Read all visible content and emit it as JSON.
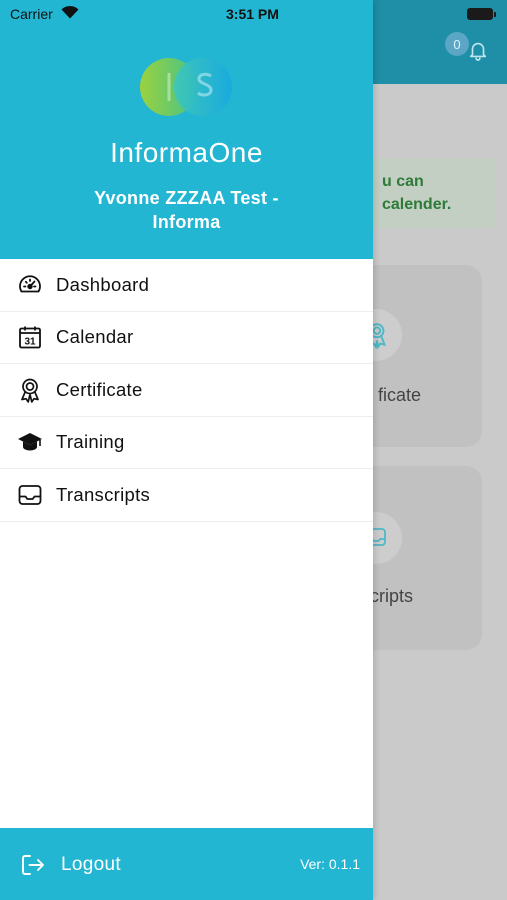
{
  "status_bar": {
    "carrier": "Carrier",
    "time": "3:51 PM"
  },
  "drawer": {
    "app_name": "InformaOne",
    "user_name": "Yvonne ZZZAA Test - Informa",
    "menu": [
      {
        "label": "Dashboard",
        "icon": "speedometer-icon"
      },
      {
        "label": "Calendar",
        "icon": "calendar-icon",
        "icon_text": "31"
      },
      {
        "label": "Certificate",
        "icon": "award-ribbon-icon"
      },
      {
        "label": "Training",
        "icon": "graduation-cap-icon"
      },
      {
        "label": "Transcripts",
        "icon": "inbox-tray-icon"
      }
    ],
    "logout_label": "Logout",
    "version": "Ver: 0.1.1"
  },
  "background": {
    "notification_count": "0",
    "notice_text_line1": "u can",
    "notice_text_line2": "calender.",
    "card1_label": "ficate",
    "card2_label": "cripts"
  },
  "colors": {
    "drawer_header": "#22b6d2",
    "background_header": "#1e8fa6",
    "overlay": "#cacaca",
    "notice_text": "#2e7a3a"
  }
}
